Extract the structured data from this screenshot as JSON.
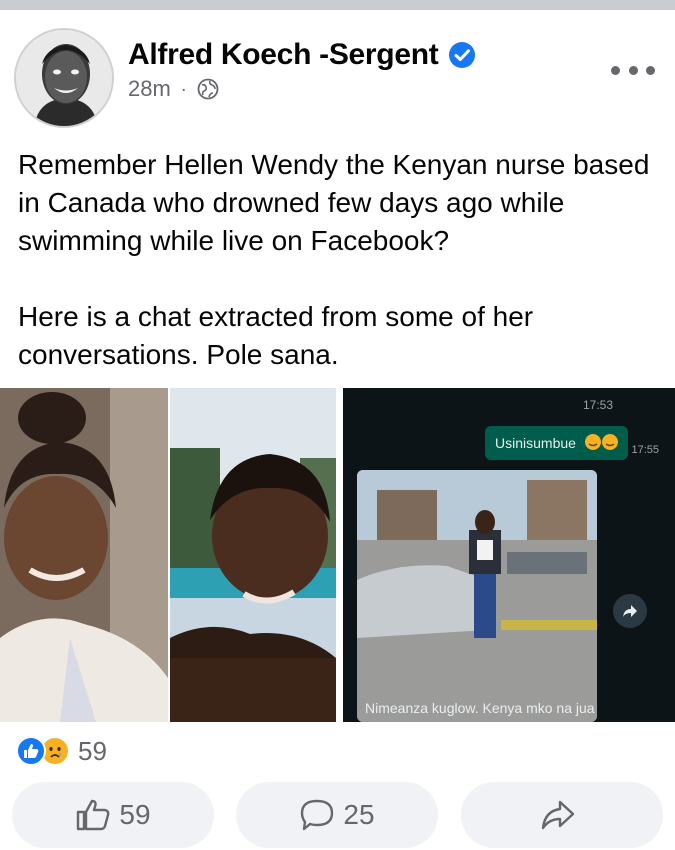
{
  "post": {
    "author": "Alfred Koech -Sergent",
    "time": "28m",
    "separator": "·",
    "paragraphs": [
      "Remember Hellen Wendy the Kenyan nurse based in Canada who drowned few days ago while swimming while live on Facebook?",
      "Here is a chat extracted from some of her conversations. Pole sana."
    ]
  },
  "chat": {
    "top_time": "17:53",
    "message": "Usinisumbue",
    "message_time": "17:55",
    "caption": "Nimeanza kuglow. Kenya mko na jua"
  },
  "reactions": {
    "count": "59"
  },
  "actions": {
    "like_count": "59",
    "comment_count": "25"
  },
  "colors": {
    "like_blue": "#1877f2",
    "sad_yellow": "#f7b125",
    "secondary_text": "#65676b",
    "chat_bubble": "#005c4b"
  },
  "icons": [
    "verified-badge-icon",
    "globe-icon",
    "more-options-icon",
    "like-reaction-icon",
    "sad-reaction-icon",
    "thumbs-up-icon",
    "comment-icon",
    "share-icon",
    "forward-icon"
  ]
}
